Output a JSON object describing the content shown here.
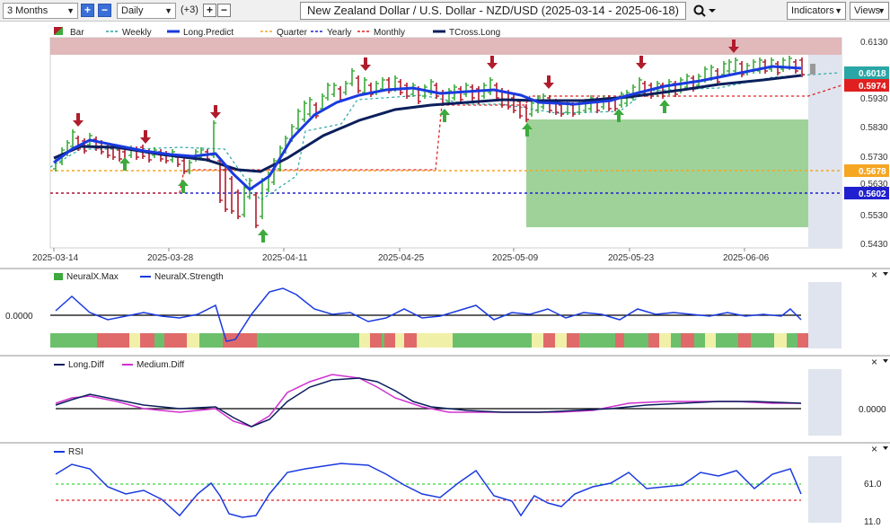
{
  "toolbar": {
    "period": "3 Months",
    "interval": "Daily",
    "indicator_count": "(+3)",
    "title": "New Zealand Dollar / U.S. Dollar - NZD/USD (2025-03-14 - 2025-06-18)",
    "indicators_label": "Indicators",
    "views_label": "Views",
    "plus": "+",
    "minus": "−"
  },
  "main_legend": [
    "Bar",
    "Weekly",
    "Long.Predict",
    "Quarter",
    "Yearly",
    "Monthly",
    "TCross.Long"
  ],
  "price_axis": [
    "0.6130",
    "0.6018",
    "0.5974",
    "0.5930",
    "0.5830",
    "0.5730",
    "0.5678",
    "0.5630",
    "0.5602",
    "0.5530",
    "0.5430"
  ],
  "price_tags": [
    {
      "value": "0.6018",
      "color": "#2aa6a6"
    },
    {
      "value": "0.5974",
      "color": "#e02020"
    },
    {
      "value": "0.5678",
      "color": "#f5a623"
    },
    {
      "value": "0.5602",
      "color": "#2020d0"
    }
  ],
  "date_axis": [
    "2025-03-14",
    "2025-03-28",
    "2025-04-11",
    "2025-04-25",
    "2025-05-09",
    "2025-05-23",
    "2025-06-06"
  ],
  "neural_panel": {
    "legend": [
      "NeuralX.Max",
      "NeuralX.Strength"
    ],
    "axis_label": "0.0000"
  },
  "diff_panel": {
    "legend": [
      "Long.Diff",
      "Medium.Diff"
    ],
    "axis_label": "0.0000"
  },
  "rsi_panel": {
    "legend": [
      "RSI"
    ],
    "axis_labels": [
      "61.0",
      "11.0"
    ]
  },
  "close_glyph": "×",
  "colors": {
    "up": "#3caa3c",
    "down": "#b01c2c",
    "long_predict": "#1a3adf",
    "tcross": "#0b1f5c",
    "weekly": "#2aa6a6",
    "quarter": "#f5a623",
    "yearly": "#2020d0",
    "monthly": "#e02020",
    "medium_diff": "#d030d0"
  }
}
